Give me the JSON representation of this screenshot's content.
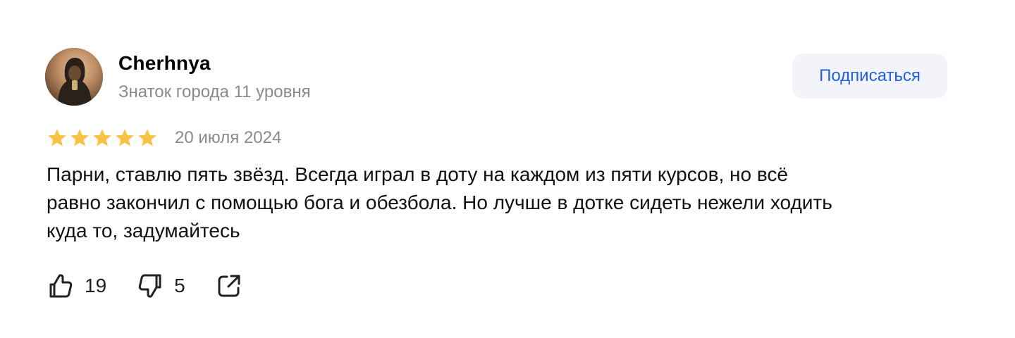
{
  "author": {
    "name": "Cherhnya",
    "rank": "Знаток города 11 уровня",
    "subscribe_label": "Подписаться"
  },
  "review": {
    "rating": 5,
    "rating_max": 5,
    "date": "20 июля 2024",
    "text_lines": [
      "Парни, ставлю пять звёзд. Всегда играл в доту на каждом из пяти курсов, но всё",
      "равно закончил с помощью бога и обезбола. Но лучше в дотке сидеть нежели ходить",
      "куда то, задумайтесь"
    ]
  },
  "reactions": {
    "likes": "19",
    "dislikes": "5"
  },
  "icons": {
    "avatar": "user-avatar-photo",
    "star": "star-icon",
    "like": "thumbs-up-icon",
    "dislike": "thumbs-down-icon",
    "share": "share-icon"
  },
  "colors": {
    "star": "#f5c343",
    "accent": "#1f5fe0",
    "button_bg": "#f3f4f9",
    "muted_text": "#8a8a8a"
  }
}
